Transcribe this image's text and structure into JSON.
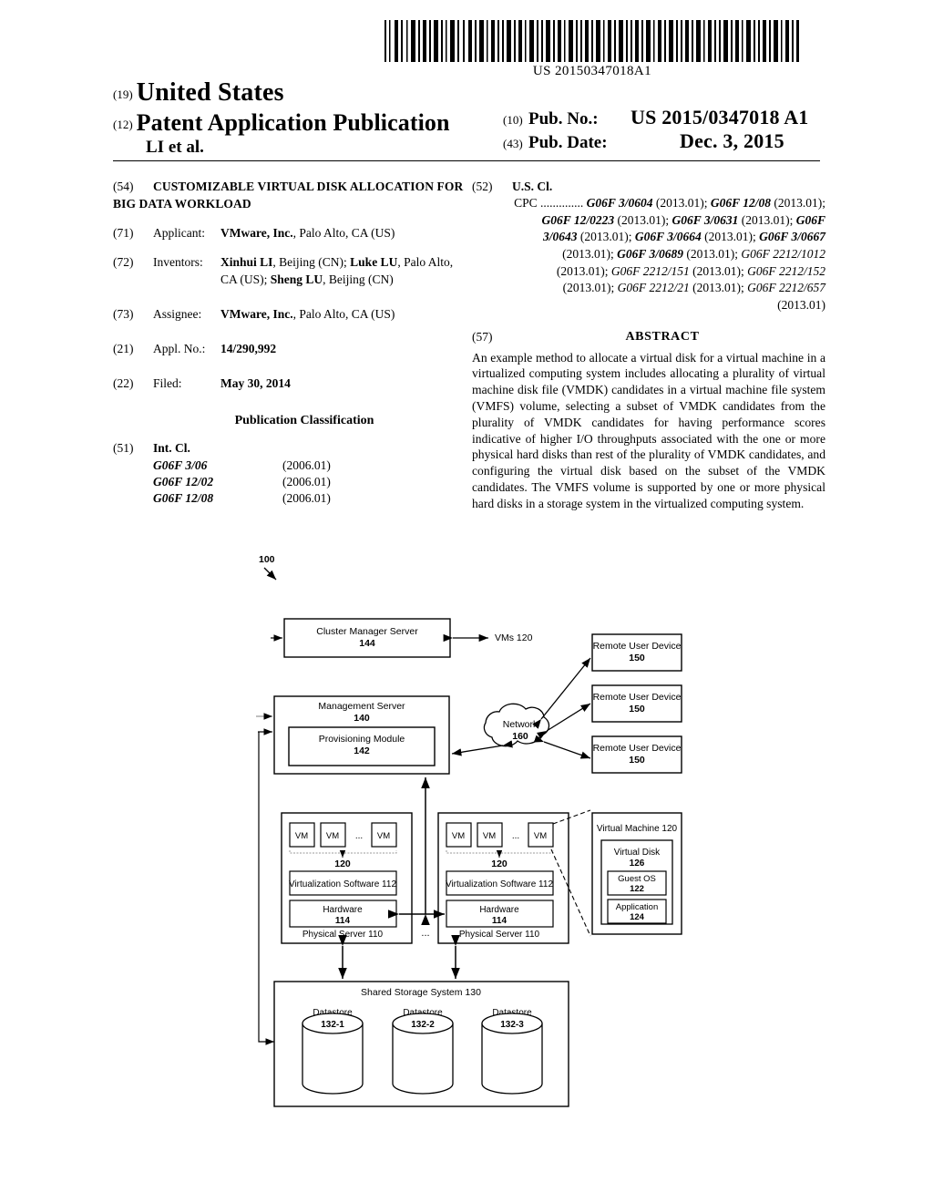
{
  "barcode": {
    "number": "US 20150347018A1"
  },
  "header": {
    "kind_19": "(19)",
    "country": "United States",
    "kind_12": "(12)",
    "doc_type": "Patent Application Publication",
    "authors": "LI et al.",
    "pubno_code": "(10)",
    "pubno_label": "Pub. No.:",
    "pubno_value": "US 2015/0347018 A1",
    "pubdate_code": "(43)",
    "pubdate_label": "Pub. Date:",
    "pubdate_value": "Dec. 3, 2015"
  },
  "left_column": {
    "title_code": "(54)",
    "title": "CUSTOMIZABLE VIRTUAL DISK ALLOCATION FOR BIG DATA WORKLOAD",
    "applicant_code": "(71)",
    "applicant_label": "Applicant:",
    "applicant_name": "VMware, Inc.",
    "applicant_rest": ", Palo Alto, CA (US)",
    "inventors_code": "(72)",
    "inventors_label": "Inventors:",
    "inventors_line1_a": "Xinhui LI",
    "inventors_line1_b": ", Beijing (CN); ",
    "inventors_line1_c": "Luke LU",
    "inventors_line1_d": ", Palo",
    "inventors_line2_a": "Alto, CA (US); ",
    "inventors_line2_b": "Sheng LU",
    "inventors_line2_c": ", Beijing (CN)",
    "assignee_code": "(73)",
    "assignee_label": "Assignee:",
    "assignee_name": "VMware, Inc.",
    "assignee_rest": ", Palo Alto, CA (US)",
    "applno_code": "(21)",
    "applno_label": "Appl. No.:",
    "applno_value": "14/290,992",
    "filed_code": "(22)",
    "filed_label": "Filed:",
    "filed_value": "May 30, 2014",
    "pubclass_heading": "Publication Classification",
    "intcl_code": "(51)",
    "intcl_label": "Int. Cl.",
    "intcl_rows": [
      {
        "code": "G06F  3/06",
        "year": "(2006.01)"
      },
      {
        "code": "G06F  12/02",
        "year": "(2006.01)"
      },
      {
        "code": "G06F  12/08",
        "year": "(2006.01)"
      }
    ]
  },
  "right_column": {
    "uscl_code": "(52)",
    "uscl_label": "U.S. Cl.",
    "cpc_prefix": "CPC ..............",
    "cpc_text_segments": [
      {
        "t": "G06F 3/0604",
        "s": "b"
      },
      {
        "t": " (2013.01); ",
        "s": "n"
      },
      {
        "t": "G06F 12/08",
        "s": "b"
      },
      {
        "t": " (2013.01); ",
        "s": "n"
      },
      {
        "t": "G06F 12/0223",
        "s": "b"
      },
      {
        "t": " (2013.01); ",
        "s": "n"
      },
      {
        "t": "G06F 3/0631",
        "s": "b"
      },
      {
        "t": " (2013.01); ",
        "s": "n"
      },
      {
        "t": "G06F 3/0643",
        "s": "b"
      },
      {
        "t": " (2013.01); ",
        "s": "n"
      },
      {
        "t": "G06F 3/0664",
        "s": "b"
      },
      {
        "t": " (2013.01); ",
        "s": "n"
      },
      {
        "t": "G06F 3/0667",
        "s": "b"
      },
      {
        "t": " (2013.01); ",
        "s": "n"
      },
      {
        "t": "G06F 3/0689",
        "s": "b"
      },
      {
        "t": " (2013.01); ",
        "s": "n"
      },
      {
        "t": "G06F 2212/1012",
        "s": "i"
      },
      {
        "t": " (2013.01); ",
        "s": "n"
      },
      {
        "t": "G06F 2212/151",
        "s": "i"
      },
      {
        "t": " (2013.01); ",
        "s": "n"
      },
      {
        "t": "G06F 2212/152",
        "s": "i"
      },
      {
        "t": " (2013.01); ",
        "s": "n"
      },
      {
        "t": "G06F 2212/21",
        "s": "i"
      },
      {
        "t": " (2013.01); ",
        "s": "n"
      },
      {
        "t": "G06F 2212/657",
        "s": "i"
      },
      {
        "t": " (2013.01)",
        "s": "n"
      }
    ],
    "abstract_code": "(57)",
    "abstract_heading": "ABSTRACT",
    "abstract_text": "An example method to allocate a virtual disk for a virtual machine in a virtualized computing system includes allocating a plurality of virtual machine disk file (VMDK) candidates in a virtual machine file system (VMFS) volume, selecting a subset of VMDK candidates from the plurality of VMDK candidates for having performance scores indicative of higher I/O throughputs associated with the one or more physical hard disks than rest of the plurality of VMDK candidates, and configuring the virtual disk based on the subset of the VMDK candidates. The VMFS volume is supported by one or more physical hard disks in a storage system in the virtualized computing system."
  },
  "figure": {
    "ref_label": "100",
    "cluster_manager": {
      "line1": "Cluster Manager Server",
      "line2": "144"
    },
    "vms_label": "VMs 120",
    "management_server": {
      "line1": "Management Server",
      "line2": "140"
    },
    "provisioning_module": {
      "line1": "Provisioning Module",
      "line2": "142"
    },
    "network": {
      "line1": "Network",
      "line2": "160"
    },
    "remote_devices": [
      {
        "line1": "Remote User Device",
        "line2": "150"
      },
      {
        "line1": "Remote User Device",
        "line2": "150"
      },
      {
        "line1": "Remote User Device",
        "line2": "150"
      }
    ],
    "vm_box_label": "VM",
    "vm_ellipsis": "...",
    "vm_group_ref": "120",
    "virtualization_software": "Virtualization Software 112",
    "hardware": {
      "line1": "Hardware",
      "line2": "114"
    },
    "physical_server": "Physical Server 110",
    "server_ellipsis": "...",
    "virtual_machine_box": {
      "title": "Virtual Machine 120",
      "virtual_disk_line1": "Virtual Disk",
      "virtual_disk_line2": "126",
      "guest_os_line1": "Guest OS",
      "guest_os_line2": "122",
      "application_line1": "Application",
      "application_line2": "124"
    },
    "shared_storage": "Shared Storage System 130",
    "datastores": [
      {
        "line1": "Datastore",
        "line2": "132-1"
      },
      {
        "line1": "Datastore",
        "line2": "132-2"
      },
      {
        "line1": "Datastore",
        "line2": "132-3"
      }
    ]
  }
}
